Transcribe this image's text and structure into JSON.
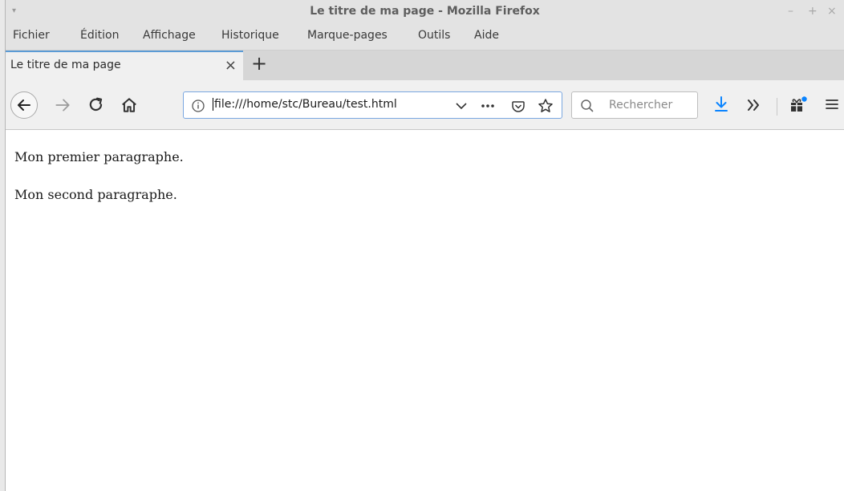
{
  "window": {
    "title": "Le titre de ma page - Mozilla Firefox",
    "controls": {
      "minimize": "–",
      "maximize": "+",
      "close": "×"
    }
  },
  "menubar": {
    "items": [
      "Fichier",
      "Édition",
      "Affichage",
      "Historique",
      "Marque-pages",
      "Outils",
      "Aide"
    ]
  },
  "tabs": [
    {
      "label": "Le titre de ma page",
      "close": "×"
    }
  ],
  "new_tab": "+",
  "navbar": {
    "url": "file:///home/stc/Bureau/test.html",
    "search_placeholder": "Rechercher",
    "icons": [
      "back-icon",
      "forward-icon",
      "reload-icon",
      "home-icon",
      "info-icon",
      "dropdown-icon",
      "page-actions-icon",
      "pocket-icon",
      "bookmark-star-icon",
      "search-icon",
      "downloads-icon",
      "overflow-icon",
      "extension-icon",
      "menu-icon"
    ],
    "accent_color": "#0a84ff"
  },
  "page": {
    "paragraphs": [
      "Mon premier paragraphe.",
      "Mon second paragraphe."
    ]
  }
}
